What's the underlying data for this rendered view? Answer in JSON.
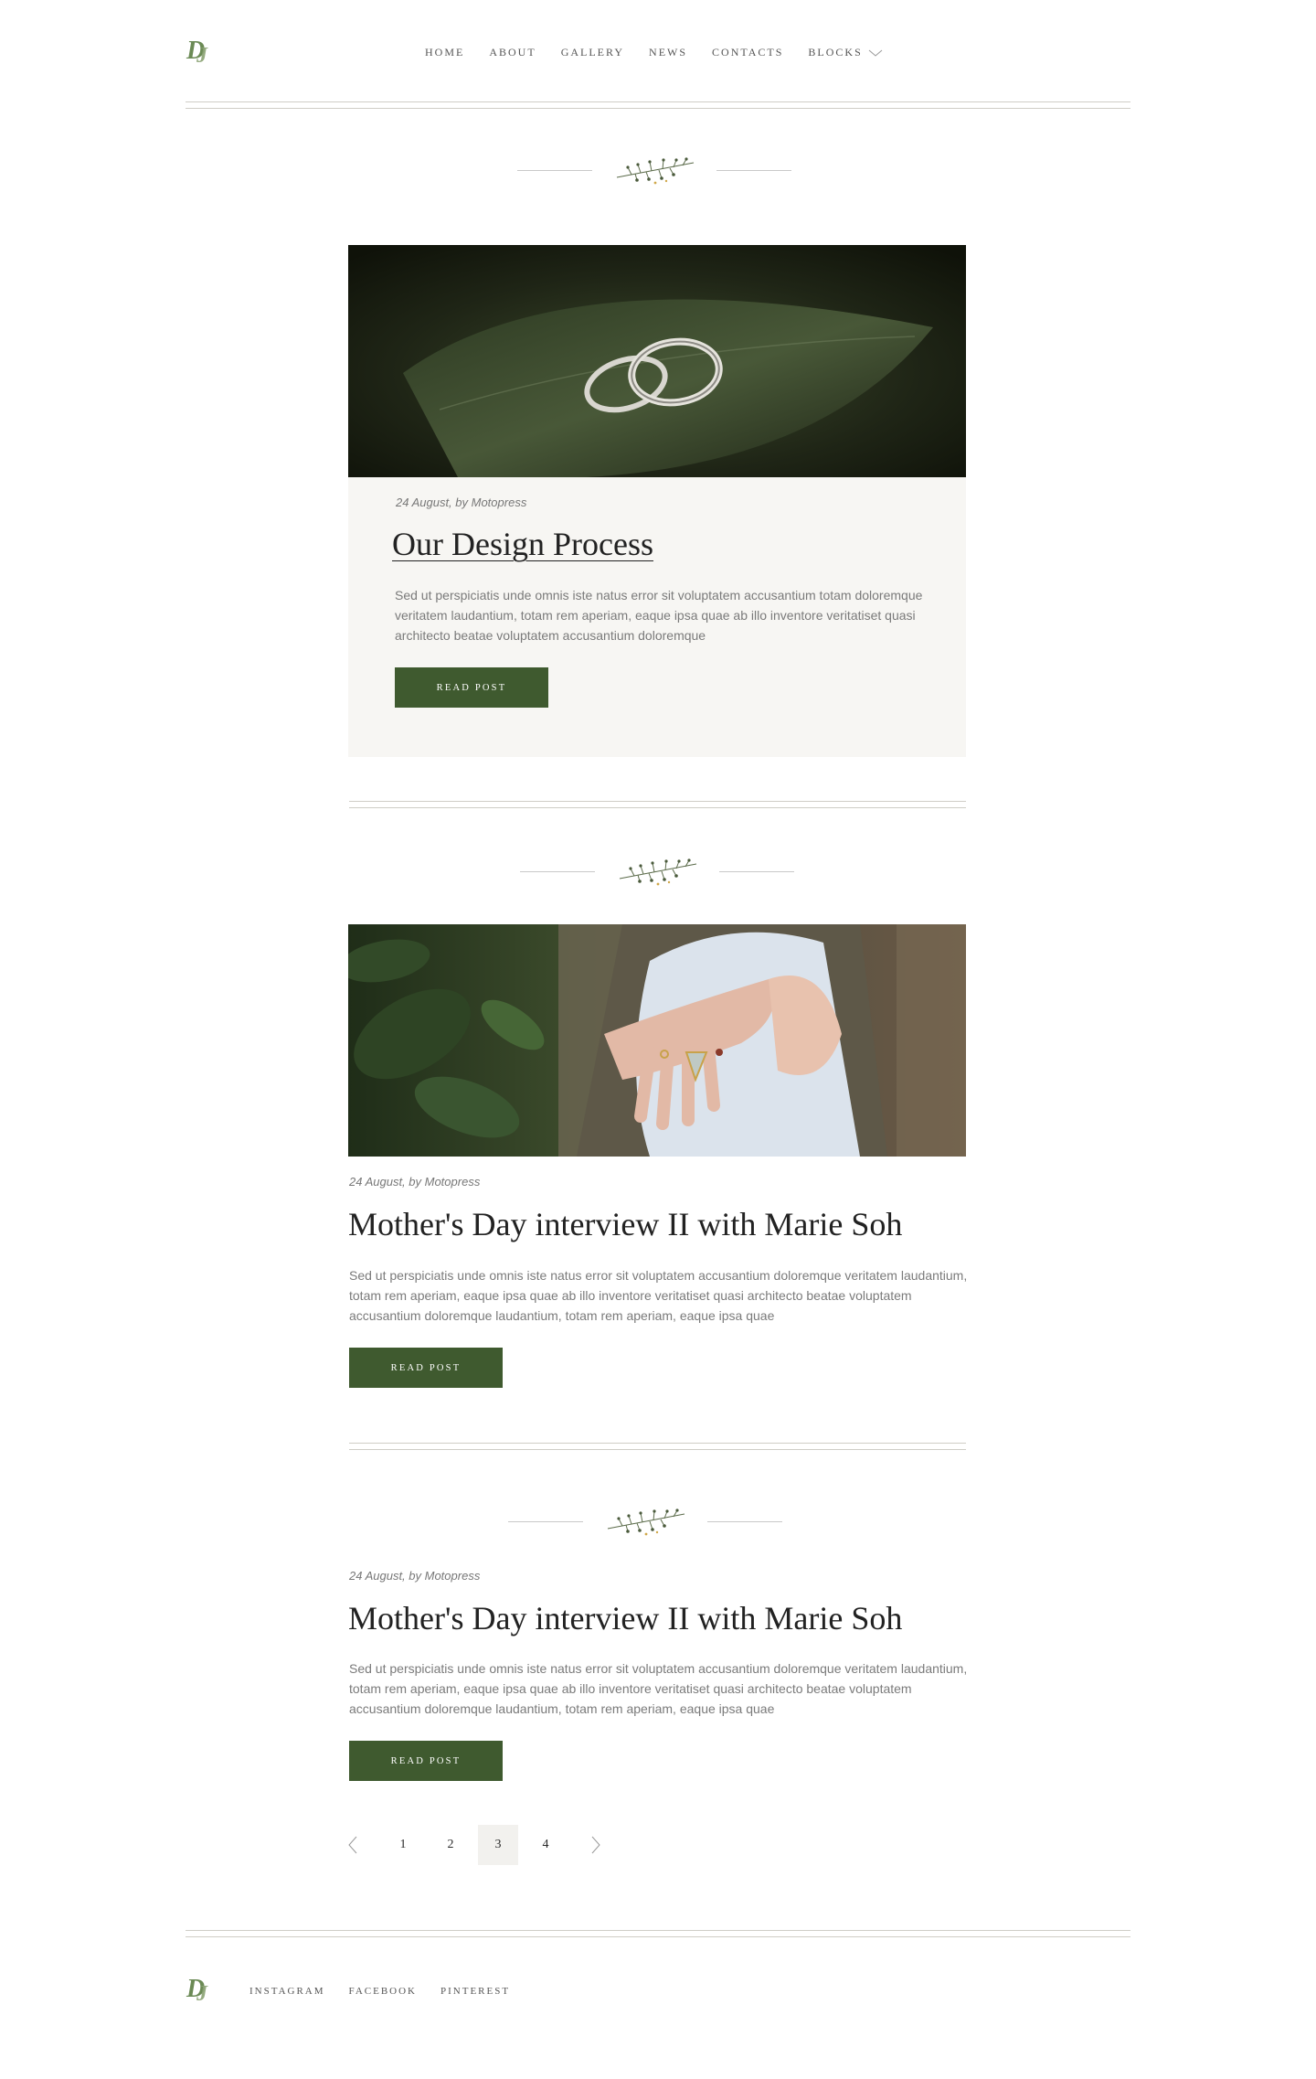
{
  "header": {
    "logo_text": "DJ",
    "nav": [
      {
        "label": "Home"
      },
      {
        "label": "About"
      },
      {
        "label": "Gallery"
      },
      {
        "label": "News"
      },
      {
        "label": "Contacts"
      },
      {
        "label": "Blocks"
      }
    ]
  },
  "posts": [
    {
      "meta": "24 August, by Motopress",
      "title": "Our Design Process",
      "excerpt": "Sed ut perspiciatis unde omnis iste natus error sit voluptatem accusantium totam doloremque veritatem laudantium, totam rem aperiam, eaque ipsa quae ab illo inventore veritatiset quasi architecto beatae voluptatem accusantium doloremque",
      "button": "Read Post",
      "image": "wedding-rings-on-leaf"
    },
    {
      "meta": "24 August, by Motopress",
      "title": "Mother's Day interview II with Marie Soh",
      "excerpt": "Sed ut perspiciatis unde omnis iste natus error sit voluptatem accusantium doloremque veritatem laudantium, totam rem aperiam, eaque ipsa quae ab illo inventore veritatiset quasi architecto beatae voluptatem accusantium doloremque laudantium, totam rem aperiam, eaque ipsa quae",
      "button": "Read Post",
      "image": "hands-with-rings"
    },
    {
      "meta": "24 August, by Motopress",
      "title": "Mother's Day interview II with Marie Soh",
      "excerpt": "Sed ut perspiciatis unde omnis iste natus error sit voluptatem accusantium doloremque veritatem laudantium, totam rem aperiam, eaque ipsa quae ab illo inventore veritatiset quasi architecto beatae voluptatem accusantium doloremque laudantium, totam rem aperiam, eaque ipsa quae",
      "button": "Read Post"
    }
  ],
  "pagination": {
    "pages": [
      "1",
      "2",
      "3",
      "4"
    ],
    "current": "3",
    "prev_icon": "chevron-left-icon",
    "next_icon": "chevron-right-icon"
  },
  "footer": {
    "links": [
      {
        "label": "Instagram"
      },
      {
        "label": "Facebook"
      },
      {
        "label": "Pinterest"
      }
    ]
  },
  "colors": {
    "accent": "#3f5a2f",
    "card_bg": "#f7f6f3",
    "rule": "#cfcdc6",
    "logo": "#6b8a55"
  }
}
